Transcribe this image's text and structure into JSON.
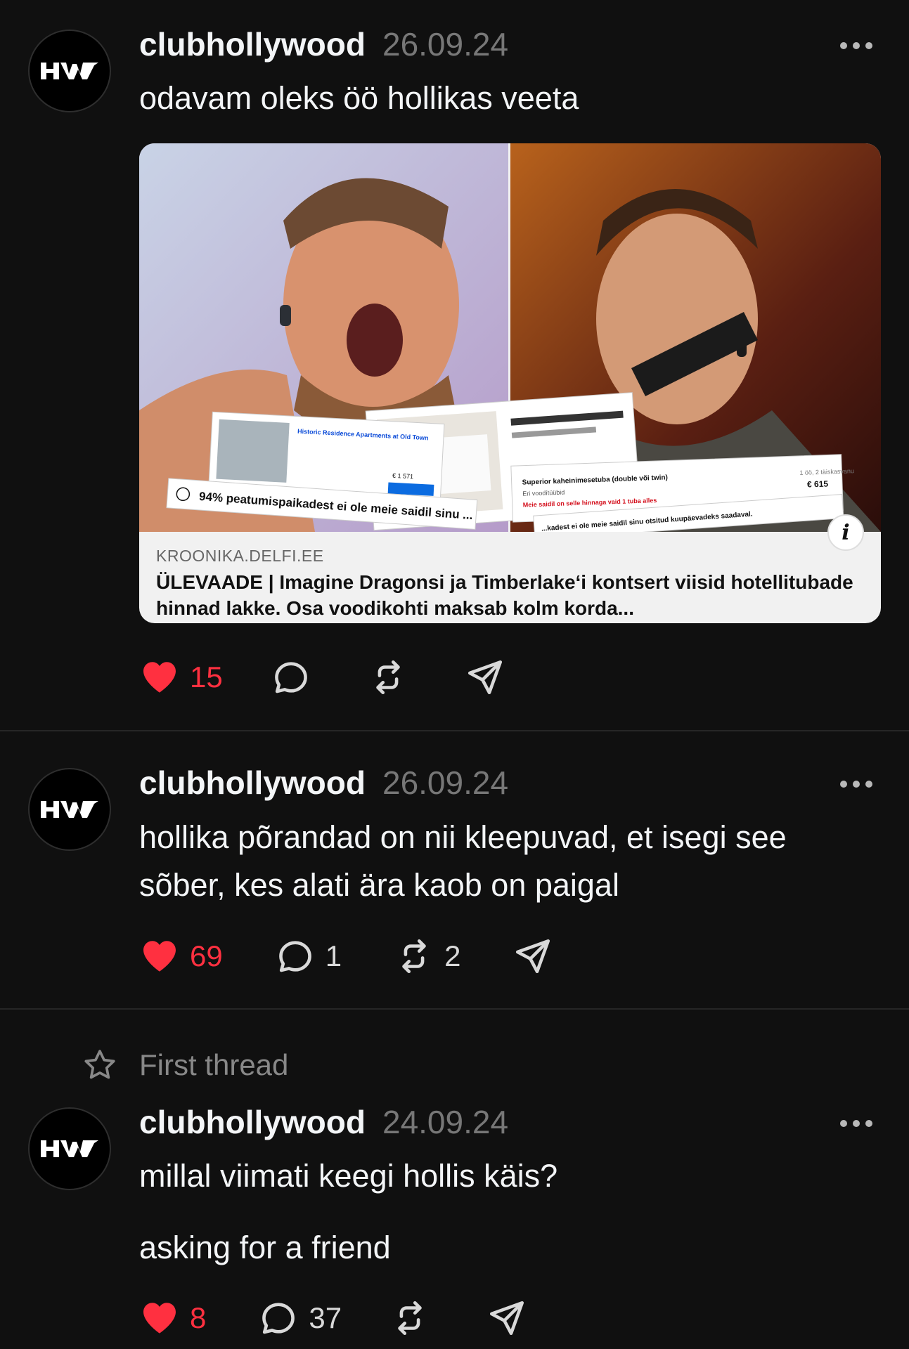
{
  "colors": {
    "background": "#101010",
    "like": "#ff3040",
    "muted": "#777777",
    "divider": "#262626"
  },
  "posts": [
    {
      "username": "clubhollywood",
      "date": "26.09.24",
      "text": "odavam oleks öö hollikas veeta",
      "link": {
        "domain": "KROONIKA.DELFI.EE",
        "title": "ÜLEVAADE | Imagine Dragonsi ja Timberlake‘i kontsert viisid hotellitubade hinnad lakke. Osa voodikohti maksab kolm korda...",
        "image_texts": {
          "banner_left": "94% peatumispaikadest ei ole meie saidil sinu ...",
          "banner_right": "...kadest ei ole meie saidil sinu otsitud kuupäevadeks saadaval.",
          "room_name": "Superior kaheinimesetuba (double või twin)",
          "room_beds": "Eri voodítüübid",
          "room_alert": "Meie saidil on selle hinnaga vaid 1 tuba alles",
          "room_price": "€ 615",
          "room_nights": "1 öö, 2 täiskasvanu",
          "hotel_name": "Historic Residence Apartments at Old Town",
          "hotel_price": "€ 1 571"
        }
      },
      "likes": "15",
      "replies": "",
      "reposts": ""
    },
    {
      "username": "clubhollywood",
      "date": "26.09.24",
      "text": "hollika põrandad on nii kleepuvad, et isegi see sõber, kes alati ära kaob on paigal",
      "likes": "69",
      "replies": "1",
      "reposts": "2"
    },
    {
      "pinned_label": "First thread",
      "username": "clubhollywood",
      "date": "24.09.24",
      "text_line1": "millal viimati keegi hollis käis?",
      "text_line2": "asking for a friend",
      "likes": "8",
      "replies": "37",
      "reposts": ""
    }
  ],
  "icons": {
    "avatar": "hw-logo",
    "like": "heart-icon",
    "reply": "comment-bubble-icon",
    "repost": "repost-icon",
    "share": "send-icon",
    "more": "more-dots-icon",
    "pinned": "star-icon",
    "info": "info-icon"
  }
}
